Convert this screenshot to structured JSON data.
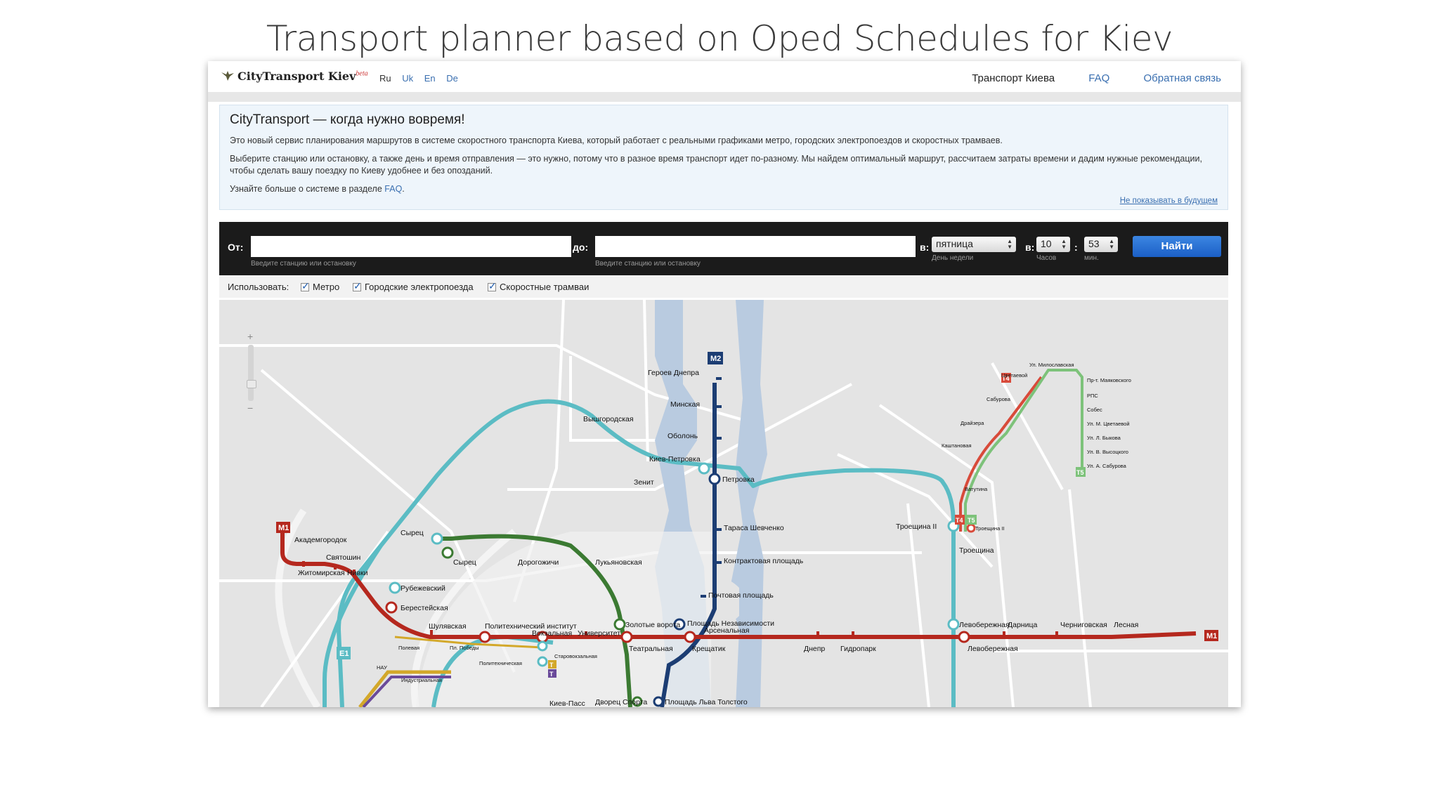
{
  "slide_title": "Transport planner based on Oped Schedules for Kiev",
  "app": {
    "name": "CityTransport Kiev",
    "badge": "beta"
  },
  "languages": [
    {
      "label": "Ru",
      "active": true
    },
    {
      "label": "Uk",
      "active": false
    },
    {
      "label": "En",
      "active": false
    },
    {
      "label": "De",
      "active": false
    }
  ],
  "nav": {
    "transport": "Транспорт Киева",
    "faq": "FAQ",
    "feedback": "Обратная связь"
  },
  "info": {
    "heading": "CityTransport — когда нужно вовремя!",
    "p1": "Это новый сервис планирования маршрутов в системе скоростного транспорта Киева, который работает с реальными графиками метро, городских электропоездов и скоростных трамваев.",
    "p2": "Выберите станцию или остановку, а также день и время отправления — это нужно, потому что в разное время транспорт идет по-разному. Мы найдем оптимальный маршрут, рассчитаем затраты времени и дадим нужные рекомендации, чтобы сделать вашу поездку по Киеву удобнее и без опозданий.",
    "p3_text": "Узнайте больше о системе в разделе",
    "p3_link": "FAQ",
    "p3_end": ".",
    "hide": "Не показывать в будущем"
  },
  "search": {
    "from_label": "От:",
    "to_label": "до:",
    "from_value": "",
    "to_value": "",
    "hint": "Введите станцию или остановку",
    "day_label": "в:",
    "day_value": "пятница",
    "day_hint": "День недели",
    "time_label": "в:",
    "hour_value": "10",
    "hour_hint": "Часов",
    "colon": ":",
    "minute_value": "53",
    "minute_hint": "мин.",
    "button": "Найти"
  },
  "modes": {
    "label": "Использовать:",
    "items": [
      {
        "label": "Метро",
        "checked": true
      },
      {
        "label": "Городские электропоезда",
        "checked": true
      },
      {
        "label": "Скоростные трамваи",
        "checked": true
      }
    ]
  },
  "colors": {
    "red_line": "#b5281e",
    "blue_line": "#1c3d73",
    "green_line": "#3b7a32",
    "city_rail": "#5bbcc4",
    "tram_red": "#d84a3a",
    "tram_green": "#7dc27a",
    "water": "#b9cbe0",
    "accent": "#3a6fb0"
  },
  "map": {
    "zoom_plus": "+",
    "zoom_minus": "−",
    "badges": {
      "m1_west": "M1",
      "m1_east": "M1",
      "m2": "M2",
      "e1": "E1",
      "t4_lobby": "T4",
      "t5_lobby": "T5",
      "t4_north": "T4",
      "t5_north": "T5",
      "t_yellow": "T",
      "t_purple": "T"
    },
    "labels": {
      "akadem": "Академгородок",
      "sviatoshyn": "Святошин",
      "zhytomyr": "Житомирская",
      "nyvky": "Нивки",
      "beresteiska": "Берестейская",
      "shuliavska": "Шулявская",
      "politekh": "Политехнический институт",
      "vokzalna": "Вокзальная",
      "universytet": "Университет",
      "teatralna": "Театральная",
      "khreshchatyk": "Крещатик",
      "arsenalna": "Арсенальная",
      "dnipro": "Днепр",
      "gidropark": "Гидропарк",
      "livoberezhna_m": "Левобережная",
      "darnytsia": "Дарница",
      "chernihivska": "Черниговская",
      "lisova": "Лесная",
      "heroiv": "Героев Днепра",
      "minska": "Минская",
      "obolon": "Оболонь",
      "petrivka": "Петровка",
      "shevchenka": "Тараса Шевченко",
      "kontraktova": "Контрактовая площадь",
      "poshtova": "Почтовая площадь",
      "nezalezhnosti": "Площадь Независимости",
      "lva": "Площадь Льва Толстого",
      "palats": "Дворец Спорта",
      "syrets_g": "Сырец",
      "dorohozhychi": "Дорогожичи",
      "lukianivska": "Лукьяновская",
      "zoloti": "Золотые ворота",
      "syrets_c": "Сырец",
      "vyshgorodska": "Вышгородская",
      "zenit": "Зенит",
      "kyiv_petrivka": "Киев-Петровка",
      "rubezhivsky": "Рубежевский",
      "kyiv_pas": "Киев-Пасс",
      "troieshchyna_ii": "Троещина II",
      "troieshchyna": "Троещина",
      "livoberezhna_c": "Левобережная",
      "darnytsia_c": "Дарница",
      "chernihivska_c": "Черниговская",
      "lisova_c": "Лесная",
      "troieshchyna_ii_t": "Троещина II",
      "vatutina": "Ватутина",
      "kashtanova": "Каштановая",
      "draizera": "Драйзера",
      "saburova": "Сабурова",
      "tsvetaevoi": "Цветаевой",
      "mylaslavska": "Ул. Милославская",
      "mayakovskoho": "Пр-т. Маяковского",
      "rps": "РПС",
      "sobes": "Собес",
      "m_tsvetaevoi": "Ул. М. Цветаевой",
      "l_bykova": "Ул. Л. Быкова",
      "v_vysotskoho": "Ул. В. Высоцкого",
      "a_saburova": "Ул. А. Сабурова",
      "nau": "НАУ",
      "polevaya": "Полевая",
      "pl_pobedy": "Пл. Победы",
      "politekhnicheskaya": "Политехническая",
      "industrialna": "Индустриальная",
      "starovokzalna": "Старовокзальная"
    }
  }
}
